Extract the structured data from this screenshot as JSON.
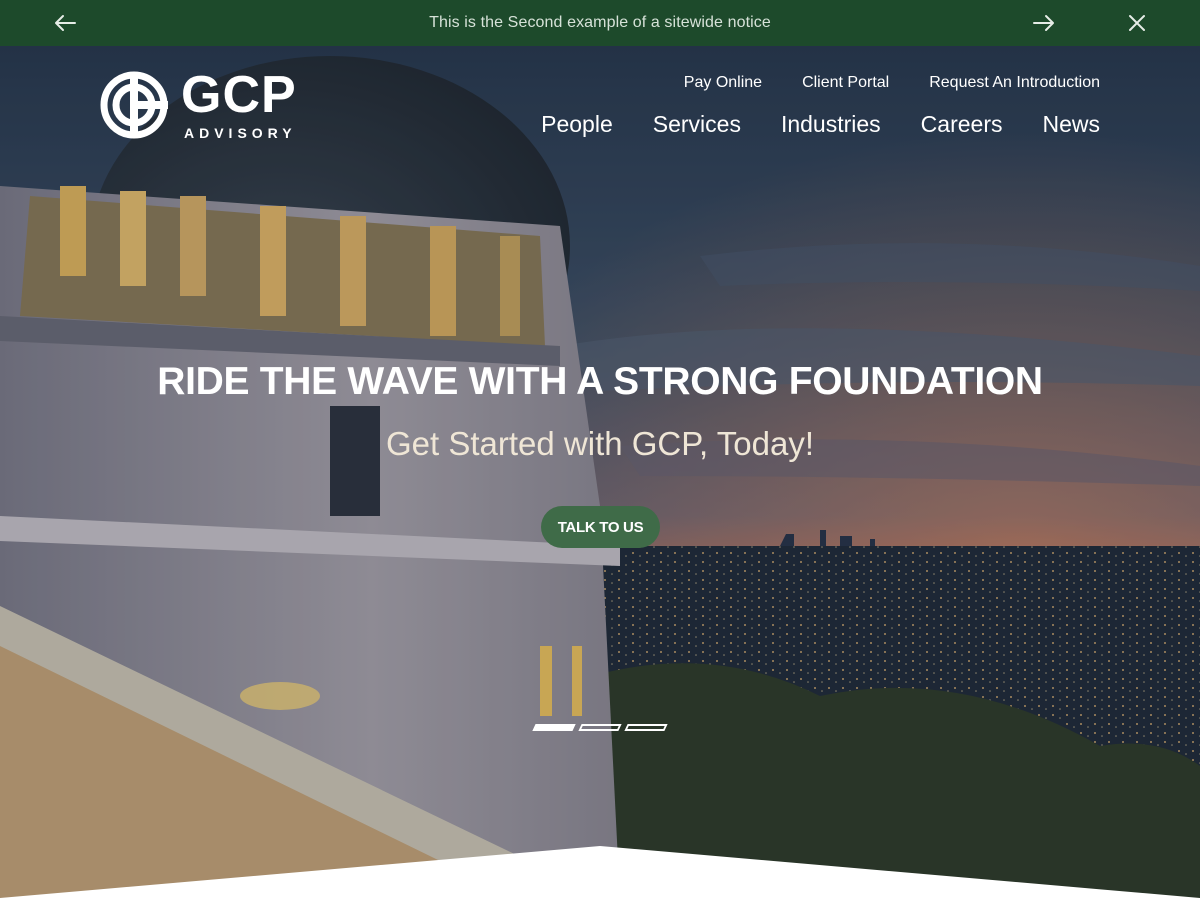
{
  "notice": {
    "text": "This is the Second example of a sitewide notice",
    "prev_icon": "arrow-left-icon",
    "next_icon": "arrow-right-icon",
    "close_icon": "close-icon"
  },
  "logo": {
    "wordmark": "GCP",
    "tagline": "ADVISORY"
  },
  "utility_nav": [
    {
      "label": "Pay Online"
    },
    {
      "label": "Client Portal"
    },
    {
      "label": "Request An Introduction"
    }
  ],
  "main_nav": [
    {
      "label": "People"
    },
    {
      "label": "Services"
    },
    {
      "label": "Industries"
    },
    {
      "label": "Careers"
    },
    {
      "label": "News"
    }
  ],
  "hero": {
    "title": "RIDE THE WAVE WITH A STRONG FOUNDATION",
    "subtitle": "Get Started with GCP, Today!",
    "cta_label": "TALK TO US",
    "slides_total": 3,
    "active_slide": 1
  },
  "colors": {
    "notice_bg": "#1d4a2b",
    "cta_bg": "#3f6b48",
    "text_light": "#ffffff"
  }
}
